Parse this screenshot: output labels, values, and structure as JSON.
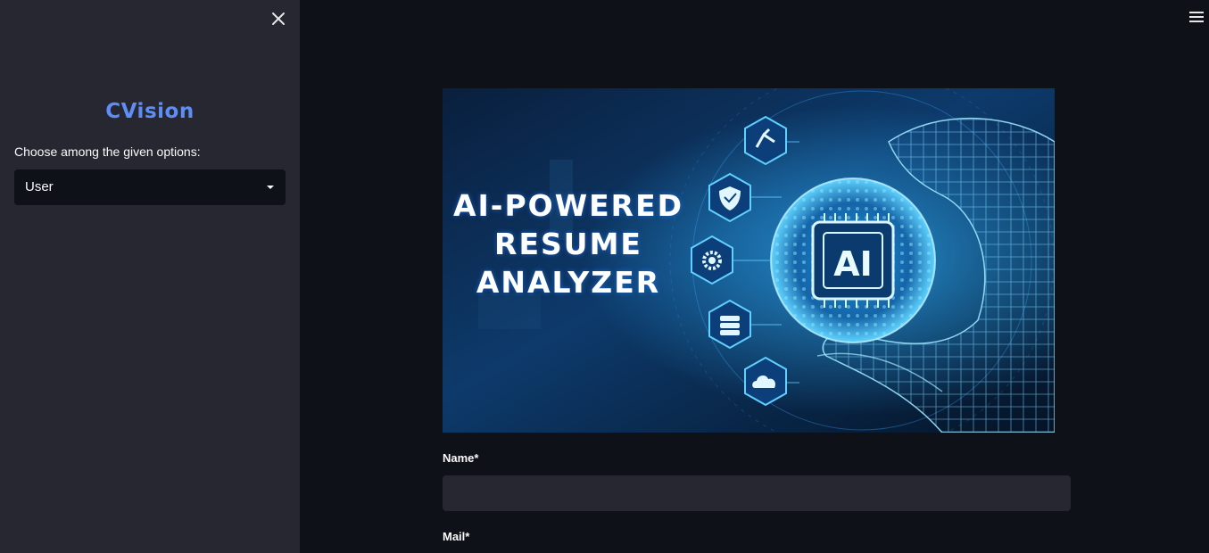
{
  "sidebar": {
    "brand": "CVision",
    "select_label": "Choose among the given options:",
    "select_value": "User",
    "close_icon": "close-icon"
  },
  "main": {
    "menu_icon": "hamburger-menu-icon",
    "hero": {
      "title_lines": [
        "AI-POWERED",
        "RESUME",
        "ANALYZER"
      ],
      "chip_text": "AI",
      "icons": [
        "robot-arm-icon",
        "shield-check-icon",
        "gear-icon",
        "database-icon",
        "cloud-icon"
      ]
    },
    "form": {
      "name_label": "Name*",
      "name_value": "",
      "mail_label": "Mail*"
    }
  },
  "colors": {
    "sidebar_bg": "#262730",
    "main_bg": "#0e1117",
    "brand": "#5e8df5",
    "input_bg": "#262730"
  }
}
